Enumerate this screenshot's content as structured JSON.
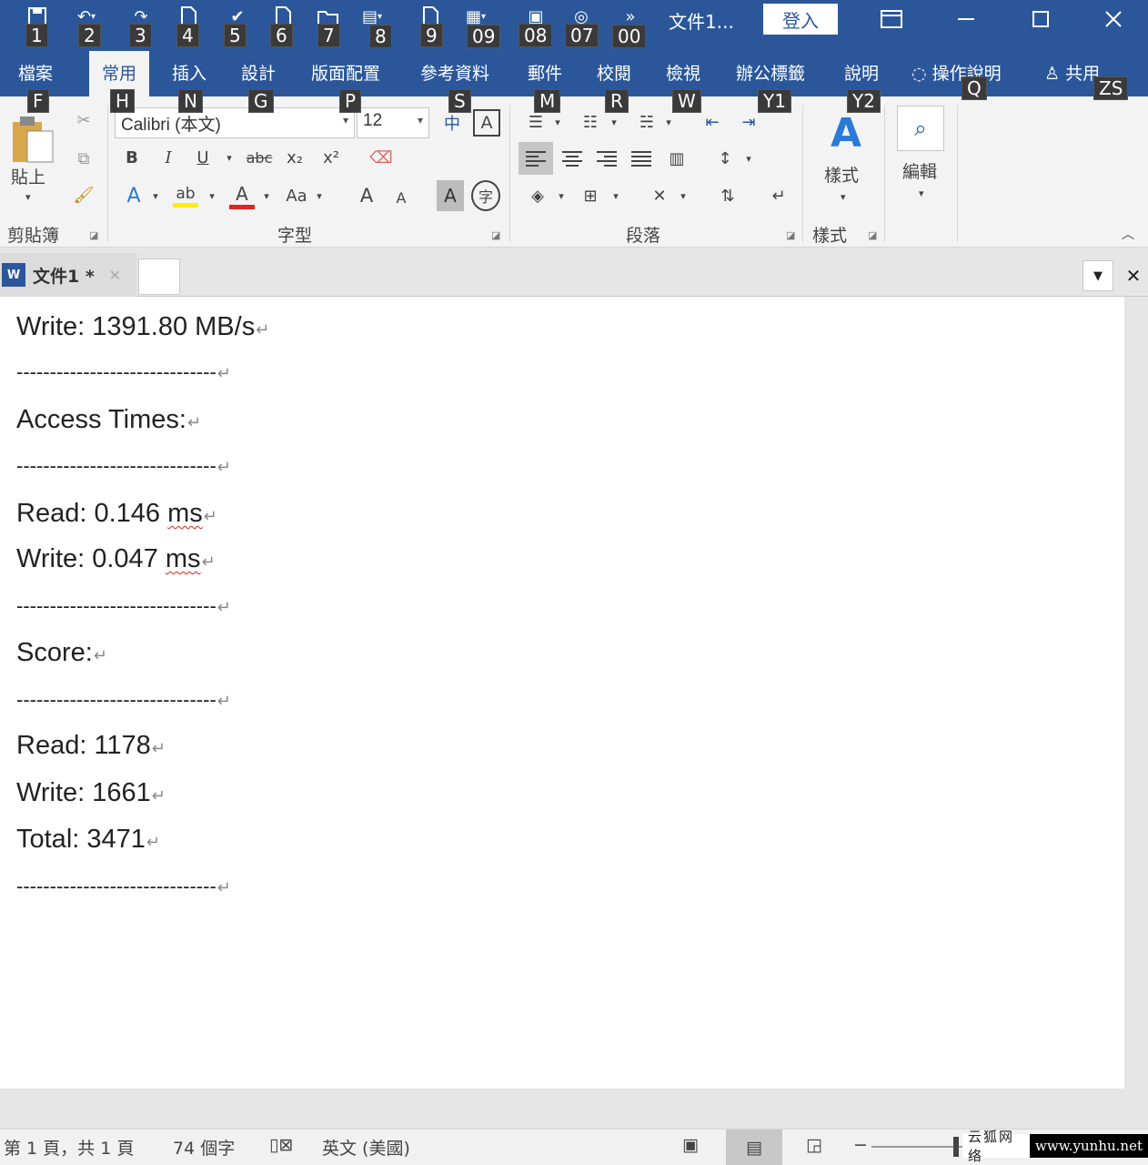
{
  "titlebar": {
    "doc_title": "文件1...",
    "login": "登入",
    "qat_keytips": [
      "1",
      "2",
      "3",
      "4",
      "5",
      "6",
      "7",
      "8",
      "9",
      "09",
      "08",
      "07",
      "00"
    ]
  },
  "tabs": [
    {
      "label": "檔案",
      "keytip": "F"
    },
    {
      "label": "常用",
      "keytip": "H"
    },
    {
      "label": "插入",
      "keytip": "N"
    },
    {
      "label": "設計",
      "keytip": "G"
    },
    {
      "label": "版面配置",
      "keytip": "P"
    },
    {
      "label": "參考資料",
      "keytip": "S"
    },
    {
      "label": "郵件",
      "keytip": "M"
    },
    {
      "label": "校閱",
      "keytip": "R"
    },
    {
      "label": "檢視",
      "keytip": "W"
    },
    {
      "label": "辦公標籤",
      "keytip": "Y1"
    },
    {
      "label": "說明",
      "keytip": "Y2"
    }
  ],
  "tell_me": {
    "label": "操作說明",
    "keytip": "Q"
  },
  "share": {
    "label": "共用",
    "keytip": "ZS"
  },
  "ribbon": {
    "clipboard": {
      "paste": "貼上",
      "group": "剪貼簿"
    },
    "font": {
      "name": "Calibri (本文)",
      "size": "12",
      "group": "字型",
      "bold": "B",
      "italic": "I",
      "underline": "U",
      "strike": "abc",
      "sub": "x₂",
      "sup": "x²",
      "case": "Aa",
      "grow": "A",
      "shrink": "A",
      "char_shade": "A",
      "enclose": "字",
      "color_a": "A",
      "phonetic": "中",
      "border_a": "A"
    },
    "paragraph": {
      "group": "段落"
    },
    "styles": {
      "label": "樣式",
      "group": "樣式"
    },
    "editing": {
      "label": "編輯"
    }
  },
  "doctab": {
    "label": "文件1 *"
  },
  "document": {
    "lines": [
      "Write: 1391.80 MB/s",
      "------------------------------",
      "Access Times:",
      "------------------------------",
      "Read: 0.146 ",
      "Write: 0.047 ",
      "------------------------------",
      "Score:",
      "------------------------------",
      "Read: 1178",
      "Write: 1661",
      "Total: 3471",
      "------------------------------"
    ],
    "unit_ms": "ms"
  },
  "status": {
    "page": "第 1 頁，共 1 頁",
    "words": "74 個字",
    "language": "英文 (美國)"
  },
  "watermark": {
    "cn": "云狐网络",
    "url": "www.yunhu.net"
  },
  "colors": {
    "title_blue": "#2b579a",
    "highlight_yellow": "#ffee00",
    "font_red": "#e32222"
  }
}
